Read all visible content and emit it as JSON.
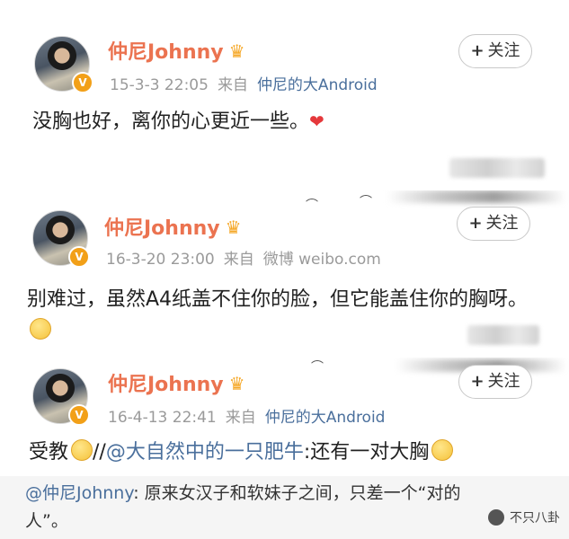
{
  "posts": [
    {
      "username": "仲尼Johnny",
      "verified_badge": "V",
      "date": "15-3-3 22:05",
      "from_label": "来自",
      "source": "仲尼的大Android",
      "follow_label": "关注",
      "text": "没胸也好，离你的心更近一些。",
      "emoji": "heart-emoji"
    },
    {
      "username": "仲尼Johnny",
      "verified_badge": "V",
      "date": "16-3-20 23:00",
      "from_label": "来自",
      "source": "微博 weibo.com",
      "follow_label": "关注",
      "text": "别难过，虽然A4纸盖不住你的脸，但它能盖住你的胸呀。",
      "emoji": "smile-emoji"
    },
    {
      "username": "仲尼Johnny",
      "verified_badge": "V",
      "date": "16-4-13 22:41",
      "from_label": "来自",
      "source": "仲尼的大Android",
      "follow_label": "关注",
      "text_prefix": "受教",
      "text_sep": "//",
      "mention": "@大自然中的一只肥牛",
      "text_suffix": ":还有一对大胸",
      "emoji": "smile-emoji"
    }
  ],
  "repost": {
    "mention": "@仲尼Johnny",
    "text": ": 原来女汉子和软妹子之间，只差一个“对的人”。"
  },
  "watermark": "不只八卦",
  "colors": {
    "username": "#eb7350",
    "link": "#4a6f9c",
    "meta": "#9a9a9a",
    "verified": "#f2a018"
  }
}
